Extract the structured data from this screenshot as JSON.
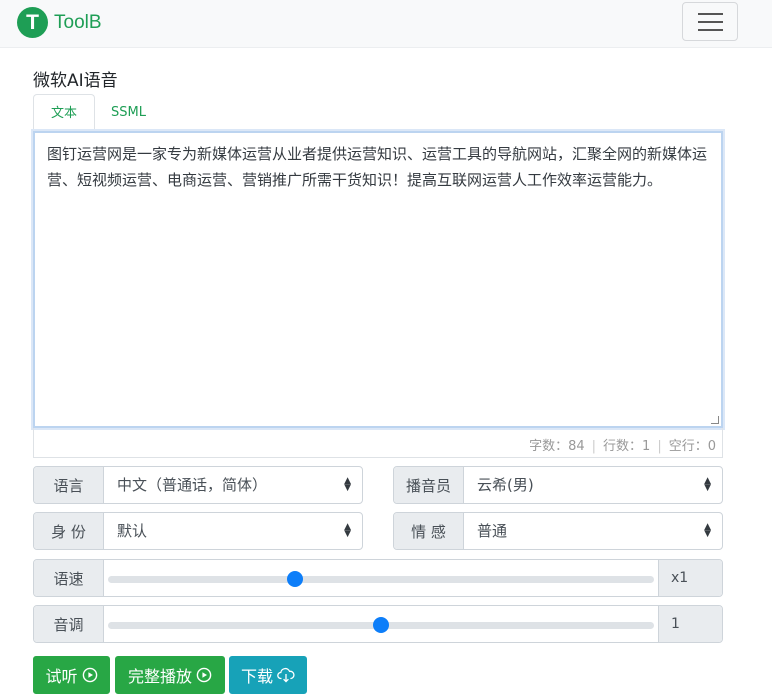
{
  "brand": {
    "logo_letter": "T",
    "name": "ToolB",
    "color": "#1e9e55"
  },
  "nav": {
    "menu_icon": "hamburger-menu-icon"
  },
  "section_title": "微软AI语音",
  "tabs": [
    {
      "label": "文本",
      "active": true
    },
    {
      "label": "SSML",
      "active": false
    }
  ],
  "editor": {
    "text": "图钉运营网是一家专为新媒体运营从业者提供运营知识、运营工具的导航网站，汇聚全网的新媒体运营、短视频运营、电商运营、营销推广所需干货知识！提高互联网运营人工作效率运营能力。"
  },
  "stats": {
    "chars_label": "字数：",
    "chars": "84",
    "lines_label": "行数：",
    "lines": "1",
    "empty_label": "空行：",
    "empty": "0"
  },
  "selects": {
    "language": {
      "label": "语言",
      "value": "中文（普通话，简体）"
    },
    "voice": {
      "label": "播音员",
      "value": "云希(男)"
    },
    "role": {
      "label": "身 份",
      "value": "默认"
    },
    "emotion": {
      "label": "情 感",
      "value": "普通"
    }
  },
  "sliders": {
    "speed": {
      "label": "语速",
      "display": "x1",
      "level": 0.34
    },
    "pitch": {
      "label": "音调",
      "display": "1",
      "level": 0.5
    }
  },
  "buttons": {
    "preview": {
      "label": "试听",
      "icon": "play-circle-icon"
    },
    "full_play": {
      "label": "完整播放",
      "icon": "play-circle-icon"
    },
    "download": {
      "label": "下载",
      "icon": "cloud-download-icon"
    }
  },
  "colors": {
    "accent_green": "#28a745",
    "accent_cyan": "#17a2b8",
    "slider_thumb": "#0d7ef9"
  }
}
